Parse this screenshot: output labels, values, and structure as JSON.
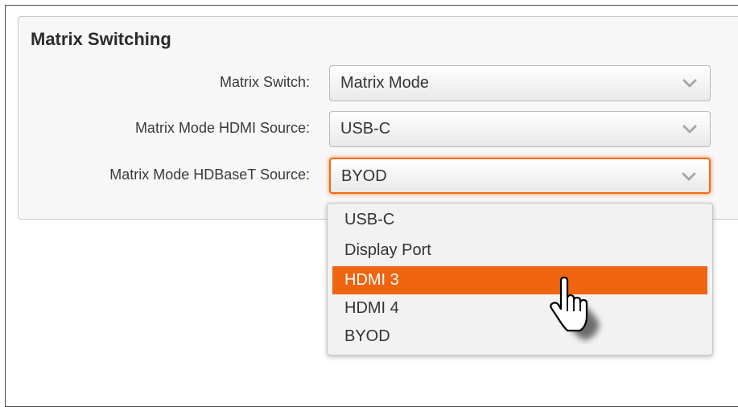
{
  "panel": {
    "title": "Matrix Switching"
  },
  "fields": [
    {
      "label": "Matrix Switch:",
      "value": "Matrix Mode"
    },
    {
      "label": "Matrix Mode HDMI Source:",
      "value": "USB-C"
    },
    {
      "label": "Matrix Mode HDBaseT Source:",
      "value": "BYOD"
    }
  ],
  "dropdown": {
    "options": [
      "USB-C",
      "Display Port",
      "HDMI 3",
      "HDMI 4",
      "BYOD"
    ],
    "highlighted": "HDMI 3"
  },
  "colors": {
    "accent": "#ef6411",
    "focus_border": "#f26b13"
  },
  "icons": {
    "chevron": "chevron-down-icon",
    "cursor": "hand-pointer-icon"
  }
}
